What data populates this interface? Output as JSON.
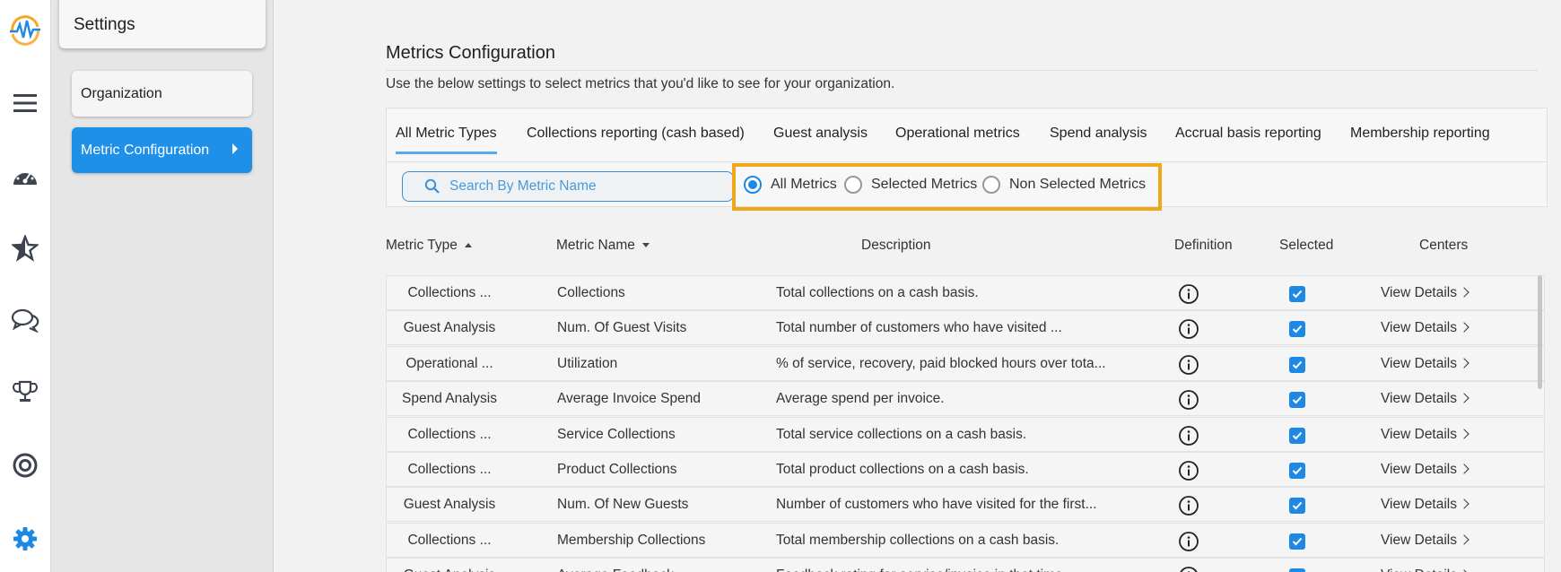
{
  "colors": {
    "accent": "#1e90e8",
    "highlight_border": "#f0a818",
    "checkbox": "#1e88e5",
    "logo_orange": "#f5a623",
    "logo_blue": "#1e88e5"
  },
  "rail": {
    "icons": [
      "logo-icon",
      "menu-icon",
      "dashboard-gauge-icon",
      "star-icon",
      "chat-icon",
      "trophy-icon",
      "target-icon",
      "settings-gear-icon"
    ]
  },
  "sidebar": {
    "title": "Settings",
    "items": [
      {
        "label": "Organization"
      },
      {
        "label": "Metric Configuration",
        "active": true
      }
    ]
  },
  "main": {
    "title": "Metrics Configuration",
    "subtitle": "Use the below settings to select metrics that you'd like to see for your organization."
  },
  "tabs": [
    {
      "label": "All Metric Types",
      "active": true
    },
    {
      "label": "Collections reporting (cash based)"
    },
    {
      "label": "Guest analysis"
    },
    {
      "label": "Operational metrics"
    },
    {
      "label": "Spend analysis"
    },
    {
      "label": "Accrual basis reporting"
    },
    {
      "label": "Membership reporting"
    }
  ],
  "search": {
    "placeholder": "Search By Metric Name",
    "value": ""
  },
  "filters": [
    {
      "label": "All Metrics",
      "selected": true
    },
    {
      "label": "Selected Metrics",
      "selected": false
    },
    {
      "label": "Non Selected Metrics",
      "selected": false
    }
  ],
  "table": {
    "headers": {
      "type": "Metric Type",
      "name": "Metric Name",
      "description": "Description",
      "definition": "Definition",
      "selected": "Selected",
      "centers": "Centers"
    },
    "view_label": "View Details",
    "rows": [
      {
        "type": "Collections ...",
        "name": "Collections",
        "description": "Total collections on a cash basis.",
        "selected": true
      },
      {
        "type": "Guest Analysis",
        "name": "Num. Of Guest Visits",
        "description": "Total number of customers who have visited ...",
        "selected": true
      },
      {
        "type": "Operational ...",
        "name": "Utilization",
        "description": "% of service, recovery, paid blocked hours over tota...",
        "selected": true
      },
      {
        "type": "Spend Analysis",
        "name": "Average Invoice Spend",
        "description": "Average spend per invoice.",
        "selected": true
      },
      {
        "type": "Collections ...",
        "name": "Service Collections",
        "description": "Total service collections on a cash basis.",
        "selected": true
      },
      {
        "type": "Collections ...",
        "name": "Product Collections",
        "description": "Total product collections on a cash basis.",
        "selected": true
      },
      {
        "type": "Guest Analysis",
        "name": "Num. Of New Guests",
        "description": "Number of customers who have visited for the first...",
        "selected": true
      },
      {
        "type": "Collections ...",
        "name": "Membership Collections",
        "description": "Total membership collections on a cash basis.",
        "selected": true
      },
      {
        "type": "Guest Analysis",
        "name": "Average Feedback",
        "description": "Feedback rating for service/invoice in that time...",
        "selected": true
      }
    ]
  }
}
